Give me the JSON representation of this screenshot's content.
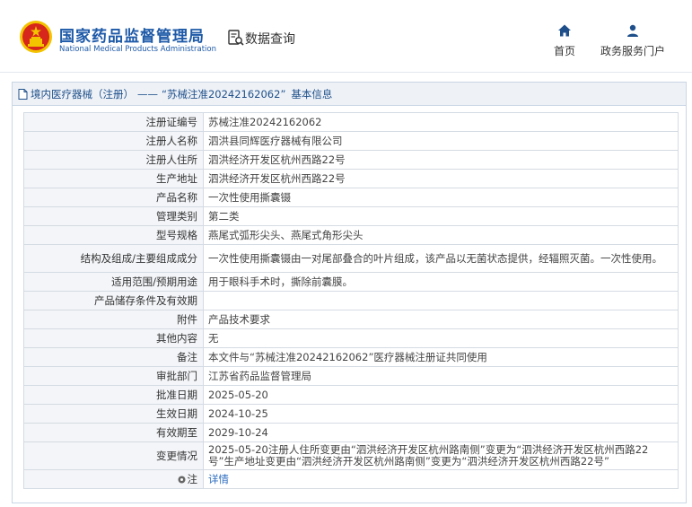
{
  "header": {
    "title": "国家药品监督管理局",
    "subtitle": "National Medical Products Administration",
    "query_title": "数据查询",
    "nav": [
      {
        "label": "首页",
        "icon": "home-icon"
      },
      {
        "label": "政务服务门户",
        "icon": "user-icon"
      }
    ]
  },
  "panel": {
    "breadcrumb_section": "境内医疗器械（注册）",
    "breadcrumb_sep": "——",
    "breadcrumb_item": "“苏械注准20242162062”",
    "breadcrumb_suffix": "基本信息"
  },
  "rows": [
    {
      "key": "注册证编号",
      "value": "苏械注准20242162062"
    },
    {
      "key": "注册人名称",
      "value": "泗洪县同辉医疗器械有限公司"
    },
    {
      "key": "注册人住所",
      "value": "泗洪经济开发区杭州西路22号"
    },
    {
      "key": "生产地址",
      "value": "泗洪经济开发区杭州西路22号"
    },
    {
      "key": "产品名称",
      "value": "一次性使用撕囊镊"
    },
    {
      "key": "管理类别",
      "value": "第二类"
    },
    {
      "key": "型号规格",
      "value": "燕尾式弧形尖头、燕尾式角形尖头"
    },
    {
      "key": "结构及组成/主要组成成分",
      "value": "一次性使用撕囊镊由一对尾部叠合的叶片组成，该产品以无菌状态提供，经辐照灭菌。一次性使用。",
      "tall": true
    },
    {
      "key": "适用范围/预期用途",
      "value": "用于眼科手术时，撕除前囊膜。"
    },
    {
      "key": "产品储存条件及有效期",
      "value": ""
    },
    {
      "key": "附件",
      "value": "产品技术要求"
    },
    {
      "key": "其他内容",
      "value": "无"
    },
    {
      "key": "备注",
      "value": "本文件与“苏械注准20242162062”医疗器械注册证共同使用"
    },
    {
      "key": "审批部门",
      "value": "江苏省药品监督管理局"
    },
    {
      "key": "批准日期",
      "value": "2025-05-20"
    },
    {
      "key": "生效日期",
      "value": "2024-10-25"
    },
    {
      "key": "有效期至",
      "value": "2029-10-24"
    },
    {
      "key": "变更情况",
      "value": "2025-05-20注册人住所变更由“泗洪经济开发区杭州路南侧”变更为“泗洪经济开发区杭州西路22号”生产地址变更由“泗洪经济开发区杭州路南侧”变更为“泗洪经济开发区杭州西路22号”",
      "tall": true
    }
  ],
  "note": {
    "key": "注",
    "link": "详情"
  },
  "colors": {
    "brand": "#1e5aa8",
    "link": "#2d6dc0",
    "emblem_red": "#d7261b",
    "emblem_gold": "#f3c300"
  }
}
